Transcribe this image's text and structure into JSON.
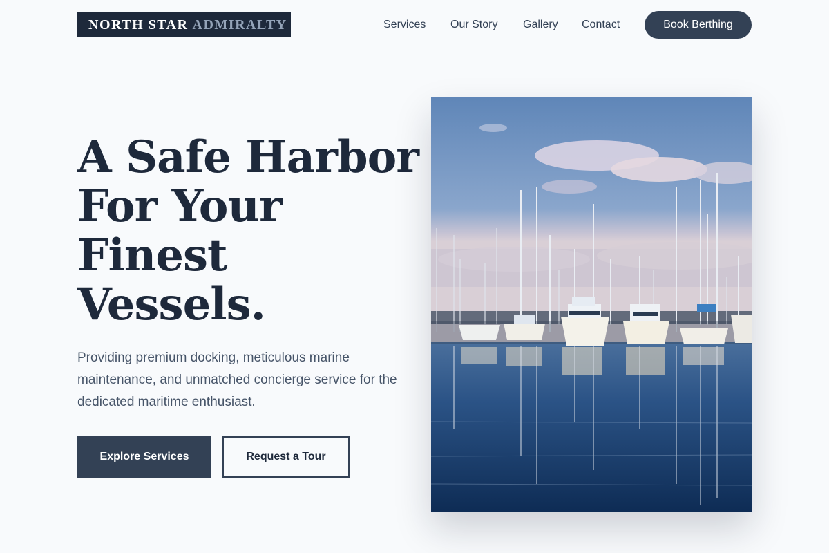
{
  "header": {
    "logo_primary": "NORTH STAR",
    "logo_secondary": "ADMIRALTY",
    "nav": [
      {
        "label": "Services"
      },
      {
        "label": "Our Story"
      },
      {
        "label": "Gallery"
      },
      {
        "label": "Contact"
      }
    ],
    "cta_label": "Book Berthing"
  },
  "hero": {
    "title_lines": [
      "A Safe Harbor",
      "For Your",
      "Finest",
      "Vessels."
    ],
    "subtitle": "Providing premium docking, meticulous marine maintenance, and unmatched concierge service for the dedicated maritime enthusiast.",
    "primary_button": "Explore Services",
    "secondary_button": "Request a Tour"
  },
  "image": {
    "alt": "Marina with sailboats and yachts reflected in calm water"
  },
  "colors": {
    "brand_dark": "#1e293b",
    "accent": "#334155",
    "background": "#f8fafc",
    "muted": "#94a3b8"
  }
}
